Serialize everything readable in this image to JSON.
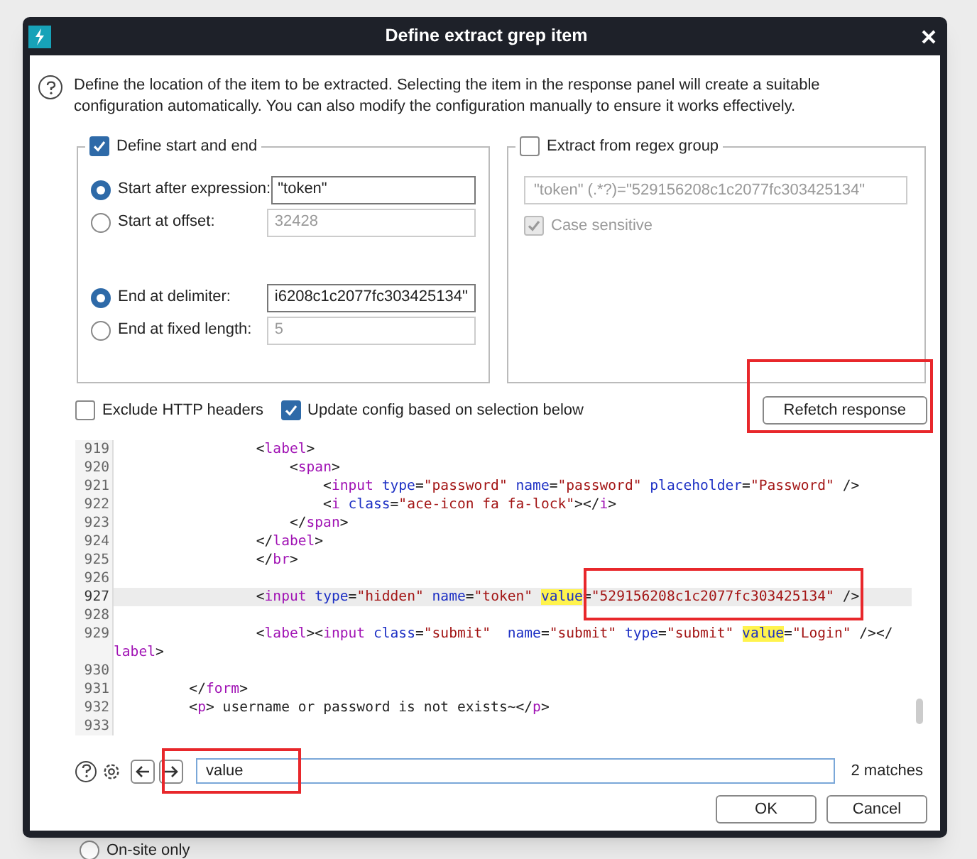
{
  "window": {
    "title": "Define extract grep item"
  },
  "description": "Define the location of the item to be extracted. Selecting the item in the response panel will create a suitable configuration automatically. You can also modify the configuration manually to ensure it works effectively.",
  "start_end_group": {
    "label": "Define start and end",
    "checked": true,
    "options": [
      {
        "label": "Start after expression:",
        "selected": true,
        "value": "\"token\"",
        "disabled": false
      },
      {
        "label": "Start at offset:",
        "selected": false,
        "value": "32428",
        "disabled": true
      },
      {
        "label": "End at delimiter:",
        "selected": true,
        "value": "i6208c1c2077fc303425134\"",
        "disabled": false
      },
      {
        "label": "End at fixed length:",
        "selected": false,
        "value": "5",
        "disabled": true
      }
    ]
  },
  "regex_group": {
    "label": "Extract from regex group",
    "checked": false,
    "value": "\"token\" (.*?)=\"529156208c1c2077fc303425134\"",
    "case_sensitive": {
      "label": "Case sensitive",
      "checked": true
    }
  },
  "options": [
    {
      "label": "Exclude HTTP headers",
      "checked": false
    },
    {
      "label": "Update config based on selection below",
      "checked": true
    }
  ],
  "refetch_button": "Refetch response",
  "code_lines": [
    {
      "number": "919",
      "current": false,
      "tokens": [
        {
          "kind": "plain",
          "text": "                <"
        },
        {
          "kind": "tag",
          "text": "label"
        },
        {
          "kind": "plain",
          "text": ">"
        }
      ]
    },
    {
      "number": "920",
      "current": false,
      "tokens": [
        {
          "kind": "plain",
          "text": "                    <"
        },
        {
          "kind": "tag",
          "text": "span"
        },
        {
          "kind": "plain",
          "text": ">"
        }
      ]
    },
    {
      "number": "921",
      "current": false,
      "tokens": [
        {
          "kind": "plain",
          "text": "                        <"
        },
        {
          "kind": "tag",
          "text": "input"
        },
        {
          "kind": "attr",
          "text": " type"
        },
        {
          "kind": "plain",
          "text": "="
        },
        {
          "kind": "value",
          "text": "\"password\""
        },
        {
          "kind": "attr",
          "text": " name"
        },
        {
          "kind": "plain",
          "text": "="
        },
        {
          "kind": "value",
          "text": "\"password\""
        },
        {
          "kind": "attr",
          "text": " placeholder"
        },
        {
          "kind": "plain",
          "text": "="
        },
        {
          "kind": "value",
          "text": "\"Password\""
        },
        {
          "kind": "plain",
          "text": " />"
        }
      ]
    },
    {
      "number": "922",
      "current": false,
      "tokens": [
        {
          "kind": "plain",
          "text": "                        <"
        },
        {
          "kind": "tag",
          "text": "i"
        },
        {
          "kind": "attr",
          "text": " class"
        },
        {
          "kind": "plain",
          "text": "="
        },
        {
          "kind": "value",
          "text": "\"ace-icon fa fa-lock\""
        },
        {
          "kind": "plain",
          "text": "></"
        },
        {
          "kind": "tag",
          "text": "i"
        },
        {
          "kind": "plain",
          "text": ">"
        }
      ]
    },
    {
      "number": "923",
      "current": false,
      "tokens": [
        {
          "kind": "plain",
          "text": "                    </"
        },
        {
          "kind": "tag",
          "text": "span"
        },
        {
          "kind": "plain",
          "text": ">"
        }
      ]
    },
    {
      "number": "924",
      "current": false,
      "tokens": [
        {
          "kind": "plain",
          "text": "                </"
        },
        {
          "kind": "tag",
          "text": "label"
        },
        {
          "kind": "plain",
          "text": ">"
        }
      ]
    },
    {
      "number": "925",
      "current": false,
      "tokens": [
        {
          "kind": "plain",
          "text": "                </"
        },
        {
          "kind": "tag",
          "text": "br"
        },
        {
          "kind": "plain",
          "text": ">"
        }
      ]
    },
    {
      "number": "926",
      "current": false
    },
    {
      "number": "927",
      "current": true,
      "tokens": [
        {
          "kind": "plain",
          "text": "                <"
        },
        {
          "kind": "tag",
          "text": "input"
        },
        {
          "kind": "attr",
          "text": " type"
        },
        {
          "kind": "plain",
          "text": "="
        },
        {
          "kind": "value",
          "text": "\"hidden\""
        },
        {
          "kind": "attr",
          "text": " name"
        },
        {
          "kind": "plain",
          "text": "="
        },
        {
          "kind": "value",
          "text": "\"token\" "
        },
        {
          "kind": "match",
          "text": "value"
        },
        {
          "kind": "plain",
          "text": "="
        },
        {
          "kind": "value",
          "text": "\"529156208c1c2077fc303425134\""
        },
        {
          "kind": "plain",
          "text": " />"
        }
      ]
    },
    {
      "number": "928",
      "current": false
    },
    {
      "number": "929",
      "current": false,
      "tokens": [
        {
          "kind": "plain",
          "text": "                <"
        },
        {
          "kind": "tag",
          "text": "label"
        },
        {
          "kind": "plain",
          "text": "><"
        },
        {
          "kind": "tag",
          "text": "input"
        },
        {
          "kind": "attr",
          "text": " class"
        },
        {
          "kind": "plain",
          "text": "="
        },
        {
          "kind": "value",
          "text": "\"submit\""
        },
        {
          "kind": "attr",
          "text": "  name"
        },
        {
          "kind": "plain",
          "text": "="
        },
        {
          "kind": "value",
          "text": "\"submit\""
        },
        {
          "kind": "attr",
          "text": " type"
        },
        {
          "kind": "plain",
          "text": "="
        },
        {
          "kind": "value",
          "text": "\"submit\" "
        },
        {
          "kind": "match",
          "text": "value"
        },
        {
          "kind": "plain",
          "text": "="
        },
        {
          "kind": "value",
          "text": "\"Login\""
        },
        {
          "kind": "plain",
          "text": " /></"
        }
      ],
      "continuation": [
        {
          "kind": "tag",
          "text": "label"
        },
        {
          "kind": "plain",
          "text": ">"
        }
      ]
    },
    {
      "number": "930",
      "current": false
    },
    {
      "number": "931",
      "current": false,
      "tokens": [
        {
          "kind": "plain",
          "text": "        </"
        },
        {
          "kind": "tag",
          "text": "form"
        },
        {
          "kind": "plain",
          "text": ">"
        }
      ]
    },
    {
      "number": "932",
      "current": false,
      "tokens": [
        {
          "kind": "plain",
          "text": "        <"
        },
        {
          "kind": "tag",
          "text": "p"
        },
        {
          "kind": "plain",
          "text": "> username or password is not exists~</"
        },
        {
          "kind": "tag",
          "text": "p"
        },
        {
          "kind": "plain",
          "text": ">"
        }
      ]
    },
    {
      "number": "933",
      "current": false
    }
  ],
  "search": {
    "value": "value",
    "matches": "2 matches"
  },
  "buttons": [
    "OK",
    "Cancel"
  ],
  "background": {
    "radio_label": "On-site only",
    "selected": false
  }
}
